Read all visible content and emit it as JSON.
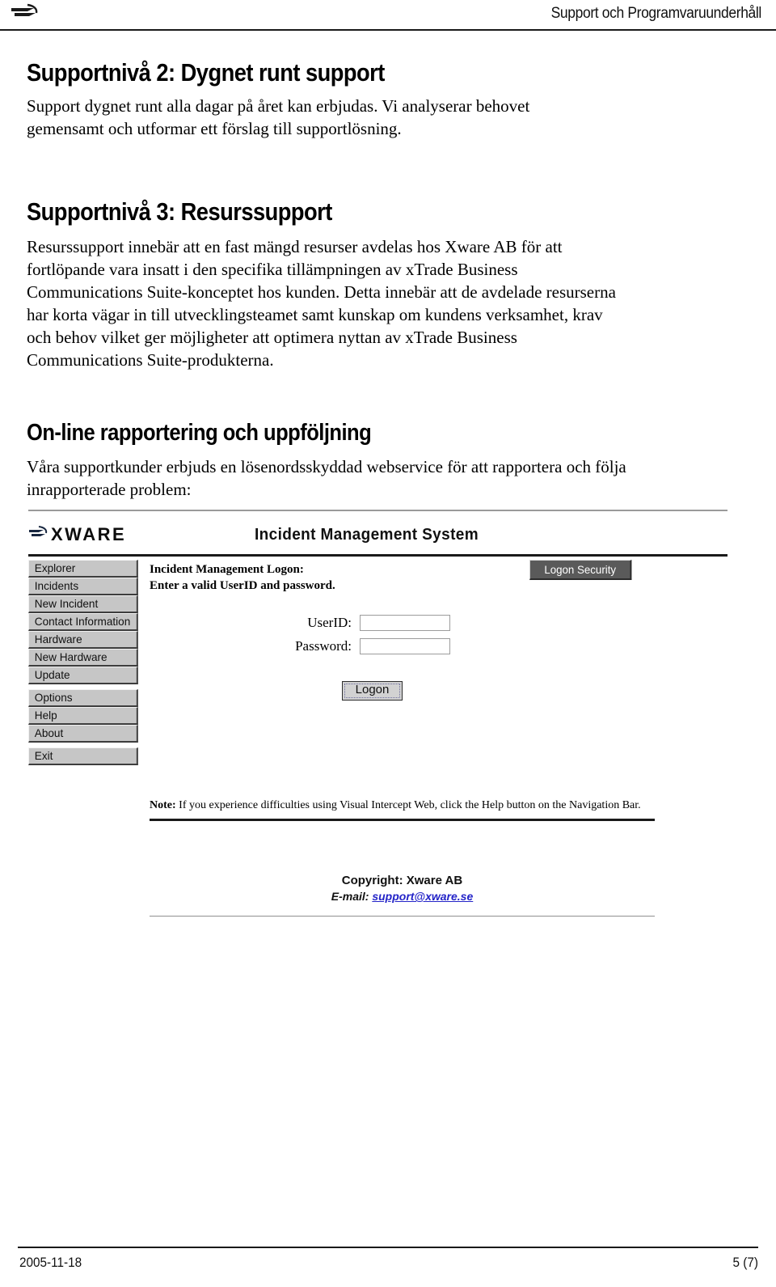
{
  "header": {
    "title": "Support och Programvaruunderhåll",
    "logo_icon": "xware-swoosh-icon"
  },
  "sections": [
    {
      "heading": "Supportnivå 2: Dygnet runt support",
      "body": "Support dygnet runt alla dagar på året kan erbjudas. Vi analyserar behovet gemensamt och utformar ett förslag till supportlösning."
    },
    {
      "heading": "Supportnivå 3: Resurssupport",
      "body": "Resurssupport innebär att en fast mängd resurser avdelas hos Xware AB för att fortlöpande vara insatt i den specifika tillämpningen av xTrade Business Communications Suite-konceptet hos kunden. Detta innebär att de avdelade resurserna har korta vägar in till utvecklingsteamet samt kunskap om kundens verksamhet, krav och behov vilket ger möjligheter att optimera nyttan av xTrade Business Communications Suite-produkterna."
    },
    {
      "heading": "On-line rapportering och uppföljning",
      "body": "Våra supportkunder erbjuds en lösenordsskyddad webservice för att rapportera och följa inrapporterade problem:"
    }
  ],
  "ims": {
    "logo_text": "XWARE",
    "logo_icon": "xware-swoosh-icon",
    "app_title": "Incident Management System",
    "nav_groups": [
      [
        "Explorer",
        "Incidents",
        "New Incident",
        "Contact Information",
        "Hardware",
        "New Hardware",
        "Update"
      ],
      [
        "Options",
        "Help",
        "About"
      ],
      [
        "Exit"
      ]
    ],
    "logon_heading": "Incident Management Logon:\nEnter a valid UserID and password.",
    "security_badge": "Logon Security",
    "fields": [
      {
        "label": "UserID:",
        "value": "",
        "placeholder": ""
      },
      {
        "label": "Password:",
        "value": "",
        "placeholder": ""
      }
    ],
    "logon_button": "Logon",
    "note_prefix": "Note:",
    "note_text": " If you experience difficulties using Visual Intercept Web, click the Help button on the Navigation Bar.",
    "copyright": "Copyright:  Xware AB",
    "email_label": "E-mail:",
    "email_address": "support@xware.se",
    "link_color": "#2323c8"
  },
  "footer": {
    "date": "2005-11-18",
    "page": "5 (7)"
  }
}
